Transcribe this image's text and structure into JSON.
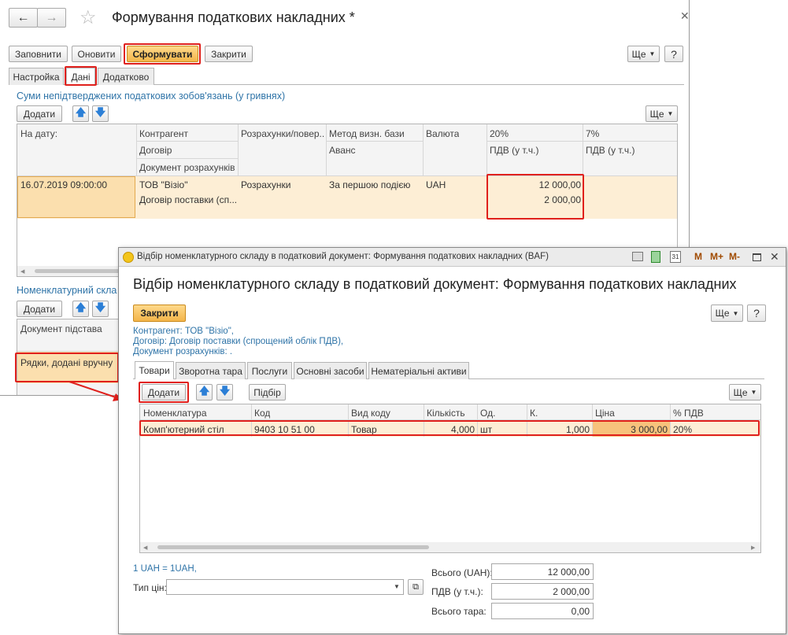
{
  "main": {
    "title": "Формування податкових накладних *",
    "toolbar": {
      "fill": "Заповнити",
      "refresh": "Оновити",
      "generate": "Сформувати",
      "close": "Закрити",
      "more": "Ще",
      "help": "?"
    },
    "tabs": [
      "Настройка",
      "Дані",
      "Додатково"
    ],
    "section1_title": "Суми непідтверджених податкових зобов'язань (у гривнях)",
    "add": "Додати",
    "more": "Ще",
    "table": {
      "headers": {
        "date": "На дату:",
        "counterparty": "Контрагент",
        "contract": "Договір",
        "settlement_doc": "Документ розрахунків",
        "settlements": "Розрахунки/повер...",
        "method": "Метод визн. бази",
        "advance": "Аванс",
        "currency": "Валюта",
        "p20": "20%",
        "vat20": "ПДВ (у т.ч.)",
        "p7": "7%",
        "vat7": "ПДВ (у т.ч.)"
      },
      "row": {
        "date": "16.07.2019 09:00:00",
        "counterparty": "ТОВ \"Візіо\"",
        "contract": "Договір поставки (сп...",
        "settlements": "Розрахунки",
        "method": "За першою подією",
        "currency": "UAH",
        "amount": "12 000,00",
        "vat": "2 000,00"
      }
    },
    "section2_title": "Номенклатурний скла",
    "section2": {
      "add": "Додати",
      "header": "Документ підстава",
      "row": "Рядки, додані вручну"
    }
  },
  "dialog": {
    "window_title": "Відбір номенклатурного складу в податковий документ: Формування податкових накладних (BAF)",
    "window_buttons": [
      "M",
      "M+",
      "M-"
    ],
    "heading": "Відбір номенклатурного складу в податковий  документ: Формування податкових накладних",
    "close": "Закрити",
    "more": "Ще",
    "help": "?",
    "info": {
      "counterparty": "Контрагент: ТОВ \"Візіо\",",
      "contract": "Договір: Договір поставки (спрощений облік ПДВ),",
      "settlement_doc": "Документ розрахунків: ."
    },
    "tabs": [
      "Товари",
      "Зворотна тара",
      "Послуги",
      "Основні засоби",
      "Нематеріальні активи"
    ],
    "add": "Додати",
    "pick": "Підбір",
    "table_more": "Ще",
    "columns": [
      "Номенклатура",
      "Код",
      "Вид коду",
      "Кількість",
      "Од.",
      "К.",
      "Ціна",
      "% ПДВ"
    ],
    "row": {
      "item": "Комп'ютерний стіл",
      "code": "9403 10 51 00",
      "code_type": "Товар",
      "qty": "4,000",
      "unit": "шт",
      "k": "1,000",
      "price": "3 000,00",
      "vat_rate": "20%"
    },
    "rate": "1 UAH = 1UAH,",
    "price_type_label": "Тип цін:",
    "totals": {
      "total_label": "Всього (UAH):",
      "total_value": "12 000,00",
      "vat_label": "ПДВ (у т.ч.):",
      "vat_value": "2 000,00",
      "tare_label": "Всього тара:",
      "tare_value": "0,00"
    }
  }
}
